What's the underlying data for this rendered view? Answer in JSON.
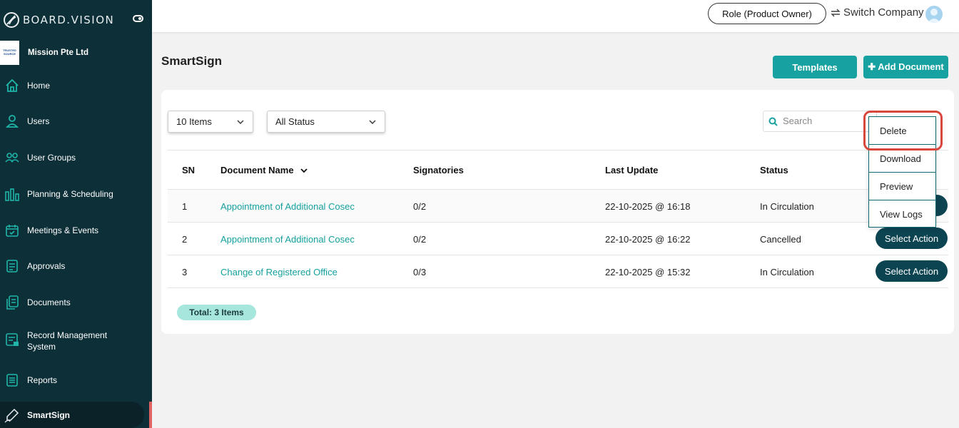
{
  "brand": {
    "name": "BOARD.VISION"
  },
  "company": {
    "name": "Mission Pte Ltd",
    "logo_text": "TRUSTED SOURCE"
  },
  "sidebar": {
    "items": [
      {
        "label": "Home",
        "icon": "home-icon"
      },
      {
        "label": "Users",
        "icon": "user-icon"
      },
      {
        "label": "User Groups",
        "icon": "user-groups-icon"
      },
      {
        "label": "Planning & Scheduling",
        "icon": "planning-icon"
      },
      {
        "label": "Meetings & Events",
        "icon": "calendar-icon"
      },
      {
        "label": "Approvals",
        "icon": "approvals-icon"
      },
      {
        "label": "Documents",
        "icon": "documents-icon"
      },
      {
        "label": "Record Management System",
        "icon": "records-icon"
      },
      {
        "label": "Reports",
        "icon": "reports-icon"
      },
      {
        "label": "SmartSign",
        "icon": "signature-pen-icon",
        "active": true
      }
    ]
  },
  "topbar": {
    "role": "Role (Product Owner)",
    "switch_company": "Switch Company"
  },
  "page": {
    "title": "SmartSign",
    "templates_btn": "Templates",
    "add_document_btn": "Add Document"
  },
  "filters": {
    "items_select": "10 Items",
    "status_select": "All Status",
    "search_placeholder": "Search"
  },
  "table": {
    "headers": {
      "sn": "SN",
      "document_name": "Document Name",
      "signatories": "Signatories",
      "last_update": "Last Update",
      "status": "Status"
    },
    "rows": [
      {
        "sn": "1",
        "name": "Appointment of Additional Cosec",
        "signatories": "0/2",
        "last_update": "22-10-2025 @ 16:18",
        "status": "In Circulation"
      },
      {
        "sn": "2",
        "name": "Appointment of Additional Cosec",
        "signatories": "0/2",
        "last_update": "22-10-2025 @ 16:22",
        "status": "Cancelled",
        "action": "Select Action"
      },
      {
        "sn": "3",
        "name": "Change of Registered Office",
        "signatories": "0/3",
        "last_update": "22-10-2025 @ 15:32",
        "status": "In Circulation",
        "action": "Select Action"
      }
    ],
    "total": "Total: 3 Items"
  },
  "action_menu": {
    "items": [
      "Delete",
      "Download",
      "Preview",
      "View Logs"
    ]
  },
  "colors": {
    "sidebar": "#0d2f38",
    "accent": "#17a2a1",
    "action": "#0d4452",
    "highlight": "#d9473c"
  }
}
